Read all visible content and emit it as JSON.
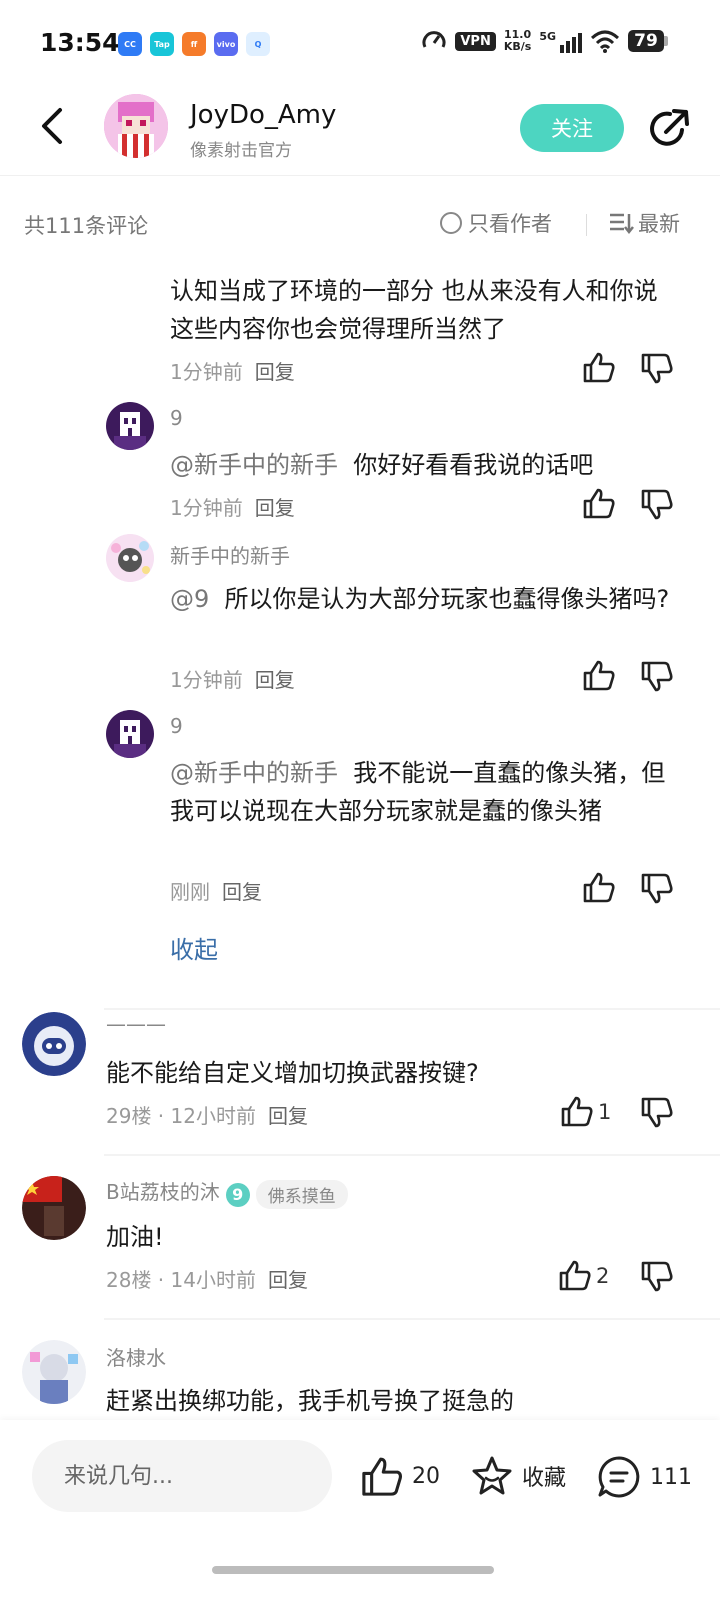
{
  "status_bar": {
    "time": "13:54",
    "apps": [
      "CC",
      "Tap",
      "ff",
      "vivo",
      "Q"
    ],
    "vpn": "VPN",
    "speed_value": "11.0",
    "speed_unit": "KB/s",
    "network": "5G",
    "battery": "79"
  },
  "header": {
    "name": "JoyDo_Amy",
    "subtitle": "像素射击官方",
    "follow_label": "关注"
  },
  "comment_bar": {
    "count_label": "共111条评论",
    "author_only_label": "只看作者",
    "sort_label": "最新"
  },
  "comments": {
    "c0": {
      "text": "认知当成了环境的一部分 也从来没有人和你说这些内容你也会觉得理所当然了",
      "time": "1分钟前",
      "reply": "回复"
    },
    "c1": {
      "user": "9",
      "mention": "@新手中的新手",
      "text": "你好好看看我说的话吧",
      "time": "1分钟前",
      "reply": "回复"
    },
    "c2": {
      "user": "新手中的新手",
      "mention": "@9",
      "text": "所以你是认为大部分玩家也蠢得像头猪吗?",
      "time": "1分钟前",
      "reply": "回复"
    },
    "c3": {
      "user": "9",
      "mention": "@新手中的新手",
      "text": "我不能说一直蠢的像头猪，但我可以说现在大部分玩家就是蠢的像头猪",
      "time": "刚刚",
      "reply": "回复"
    },
    "collapse_label": "收起",
    "c4": {
      "user": "———",
      "text": "能不能给自定义增加切换武器按键?",
      "floor_time": "29楼 · 12小时前",
      "reply": "回复",
      "likes": "1"
    },
    "c5": {
      "user": "B站荔枝的沐",
      "level": "9",
      "tag": "佛系摸鱼",
      "text": "加油!",
      "floor_time": "28楼 · 14小时前",
      "reply": "回复",
      "likes": "2"
    },
    "c6": {
      "user": "洛棣水",
      "text": "赶紧出换绑功能，我手机号换了挺急的"
    }
  },
  "bottom_bar": {
    "input_placeholder": "来说几句...",
    "likes": "20",
    "favorite_label": "收藏",
    "comments": "111"
  },
  "colors": {
    "accent": "#4dd5c1",
    "link": "#3a6ea8"
  }
}
